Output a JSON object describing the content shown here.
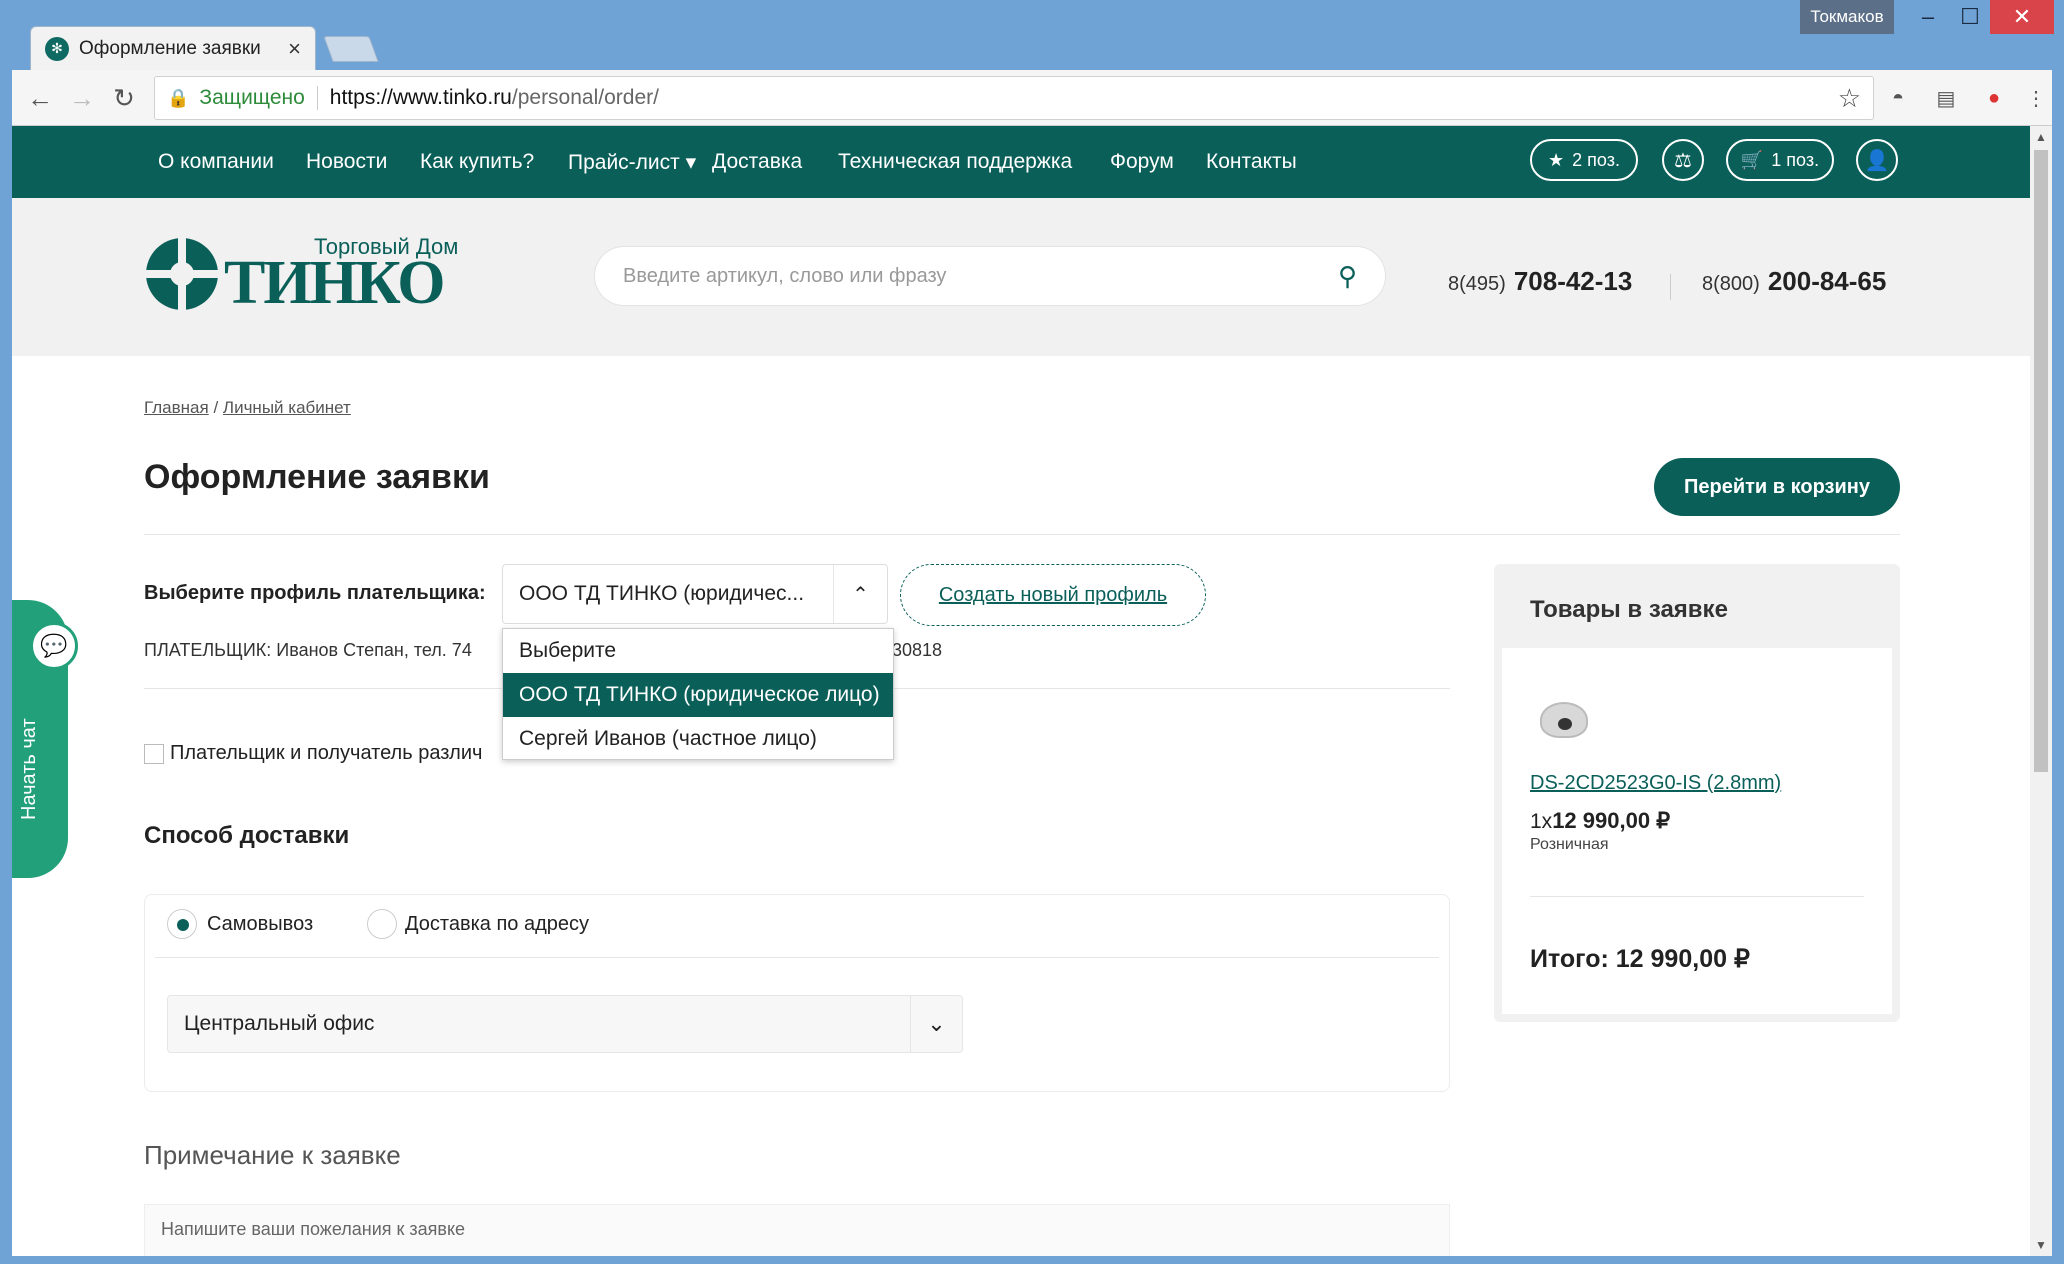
{
  "window": {
    "user": "Токмаков",
    "tab_title": "Оформление заявки"
  },
  "address": {
    "secure": "Защищено",
    "url_host": "https://www.tinko.ru",
    "url_path": "/personal/order/"
  },
  "topnav": {
    "items": [
      "О компании",
      "Новости",
      "Как купить?",
      "Прайс-лист ▾",
      "Доставка",
      "Техническая поддержка",
      "Форум",
      "Контакты"
    ],
    "favorites": "2 поз.",
    "cart": "1 поз."
  },
  "header": {
    "logo_sub": "Торговый Дом",
    "logo_main": "ТИНКО",
    "search_placeholder": "Введите артикул, слово или фразу",
    "phone1_code": "8(495)",
    "phone1_num": "708-42-13",
    "phone2_code": "8(800)",
    "phone2_num": "200-84-65"
  },
  "breadcrumb": {
    "home": "Главная",
    "sep": "/",
    "account": "Личный кабинет"
  },
  "page_title": "Оформление заявки",
  "go_to_cart": "Перейти в корзину",
  "payer": {
    "label": "Выберите профиль плательщика:",
    "selected": "ООО ТД ТИНКО (юридичес...",
    "create_profile": "Создать новый профиль",
    "options": [
      "Выберите",
      "ООО ТД ТИНКО (юридическое лицо)",
      "Сергей Иванов (частное лицо)"
    ],
    "info_left": "ПЛАТЕЛЬЩИК: Иванов Степан, тел. 74",
    "info_right": "30818",
    "differ_label": "Плательщик и получатель различ"
  },
  "delivery": {
    "title": "Способ доставки",
    "pickup": "Самовывоз",
    "address": "Доставка по адресу",
    "office": "Центральный офис"
  },
  "note": {
    "title": "Примечание к заявке",
    "placeholder": "Напишите ваши пожелания к заявке"
  },
  "order": {
    "title": "Товары в заявке",
    "product": "DS-2CD2523G0-IS (2.8mm)",
    "qty": "1x",
    "price": "12 990,00 ₽",
    "price_type": "Розничная",
    "total": "Итого: 12 990,00 ₽"
  },
  "chat": {
    "label": "Начать чат"
  }
}
